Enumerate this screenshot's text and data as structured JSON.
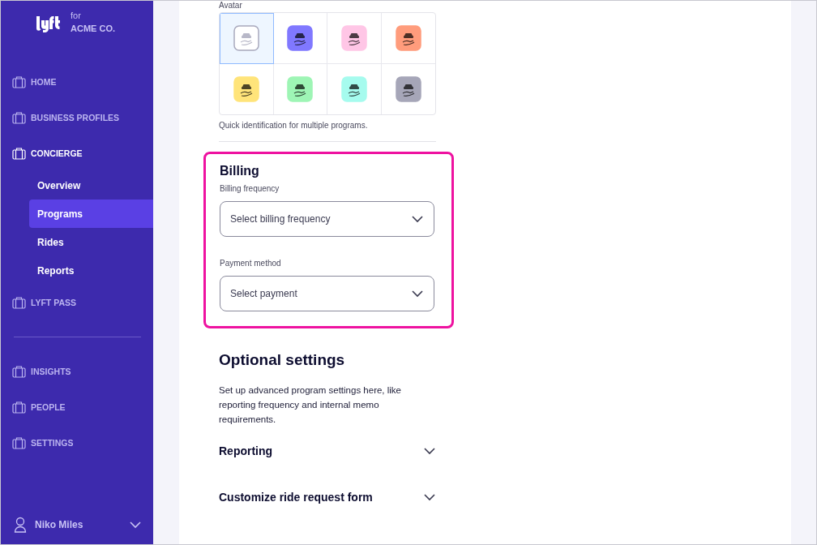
{
  "sidebar": {
    "brand": {
      "for": "for",
      "company": "ACME CO."
    },
    "items": [
      {
        "label": "HOME",
        "expanded": false
      },
      {
        "label": "BUSINESS PROFILES",
        "expanded": false
      },
      {
        "label": "CONCIERGE",
        "expanded": true,
        "children": [
          {
            "label": "Overview",
            "selected": false
          },
          {
            "label": "Programs",
            "selected": true
          },
          {
            "label": "Rides",
            "selected": false
          },
          {
            "label": "Reports",
            "selected": false
          }
        ]
      },
      {
        "label": "LYFT PASS",
        "expanded": false
      }
    ],
    "items_2": [
      {
        "label": "INSIGHTS"
      },
      {
        "label": "PEOPLE"
      },
      {
        "label": "SETTINGS"
      }
    ],
    "user": {
      "name": "Niko Miles"
    }
  },
  "avatar": {
    "label": "Avatar",
    "hint": "Quick identification for multiple programs.",
    "options": [
      {
        "color": "#ffffff",
        "selected": true
      },
      {
        "color": "#8078ff",
        "selected": false
      },
      {
        "color": "#ffc6e6",
        "selected": false
      },
      {
        "color": "#ff9c7c",
        "selected": false
      },
      {
        "color": "#ffe47a",
        "selected": false
      },
      {
        "color": "#9ef5b5",
        "selected": false
      },
      {
        "color": "#a6fbee",
        "selected": false
      },
      {
        "color": "#a6a6b8",
        "selected": false
      }
    ]
  },
  "billing": {
    "title": "Billing",
    "fields": [
      {
        "label": "Billing frequency",
        "placeholder": "Select billing frequency"
      },
      {
        "label": "Payment method",
        "placeholder": "Select payment"
      }
    ]
  },
  "optional": {
    "title": "Optional settings",
    "description": "Set up advanced program settings here, like reporting frequency and internal memo requirements.",
    "sections": [
      {
        "label": "Reporting",
        "expanded": false
      },
      {
        "label": "Customize ride request form",
        "expanded": false
      }
    ]
  }
}
